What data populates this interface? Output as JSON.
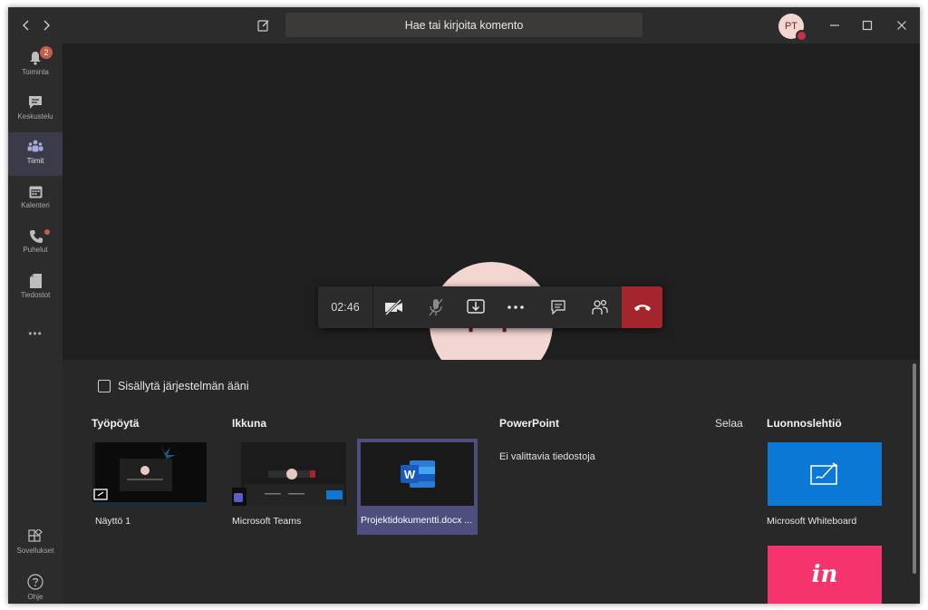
{
  "titlebar": {
    "search_placeholder": "Hae tai kirjoita komento",
    "avatar_initials": "PT"
  },
  "sidebar": {
    "items": [
      {
        "label": "Toiminta",
        "icon": "bell-icon",
        "badge": "2"
      },
      {
        "label": "Keskustelu",
        "icon": "chat-icon"
      },
      {
        "label": "Tiimit",
        "icon": "teams-icon",
        "active": true
      },
      {
        "label": "Kalenteri",
        "icon": "calendar-icon"
      },
      {
        "label": "Puhelut",
        "icon": "phone-icon",
        "dot": true
      },
      {
        "label": "Tiedostot",
        "icon": "file-icon"
      }
    ],
    "more": "•••",
    "bottom": [
      {
        "label": "Sovellukset",
        "icon": "apps-icon"
      },
      {
        "label": "Ohje",
        "icon": "help-icon"
      }
    ]
  },
  "call": {
    "participant_initials": "PT",
    "timer": "02:46",
    "controls": [
      "camera-off-icon",
      "mic-off-icon",
      "share-tray-icon",
      "more-icon",
      "chat-icon",
      "participants-icon",
      "hangup-icon"
    ]
  },
  "share": {
    "include_system_audio": "Sisällytä järjestelmän ääni",
    "desktop": {
      "header": "Työpöytä",
      "items": [
        {
          "label": "Näyttö 1"
        }
      ]
    },
    "window": {
      "header": "Ikkuna",
      "items": [
        {
          "label": "Microsoft Teams"
        },
        {
          "label": "Projektidokumentti.docx ..."
        }
      ]
    },
    "powerpoint": {
      "header": "PowerPoint",
      "browse": "Selaa",
      "empty": "Ei valittavia tiedostoja"
    },
    "whiteboard": {
      "header": "Luonnoslehtiö",
      "items": [
        {
          "label": "Microsoft Whiteboard"
        },
        {
          "label": "in"
        }
      ]
    }
  },
  "colors": {
    "accent": "#6264a7",
    "hangup": "#a4262c",
    "whiteboard": "#0a78d4",
    "invision": "#f5336d"
  }
}
